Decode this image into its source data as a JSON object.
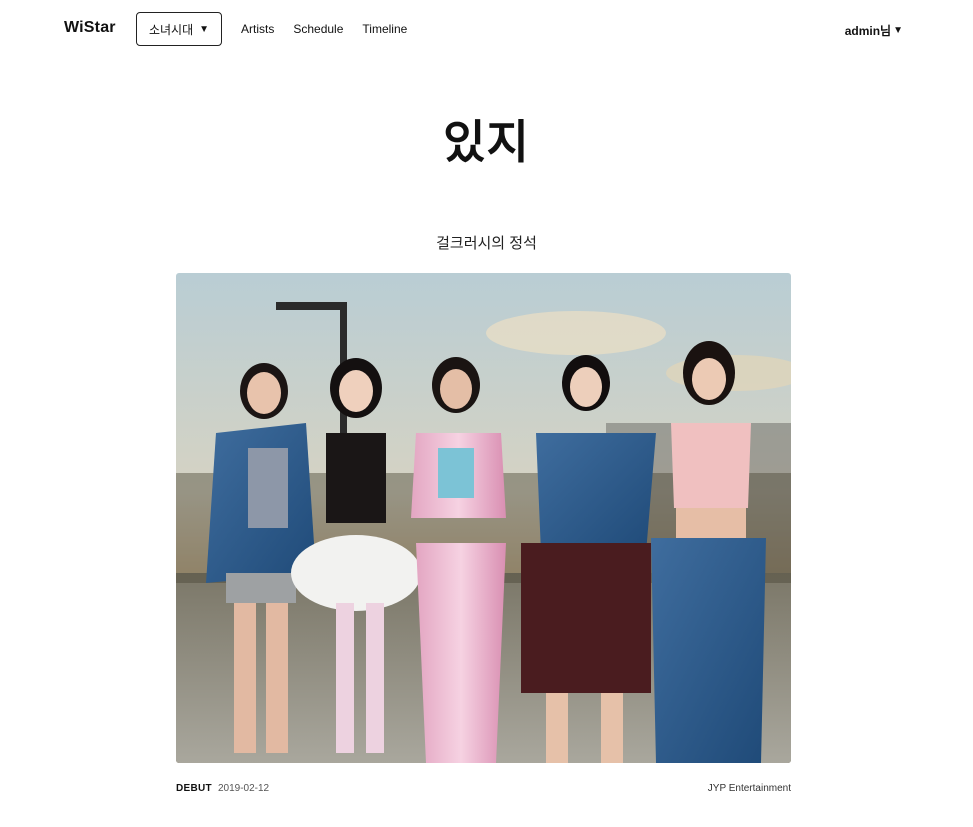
{
  "header": {
    "logo": "WiStar",
    "group_select": {
      "selected": "소녀시대",
      "caret": "▼"
    },
    "nav": [
      "Artists",
      "Schedule",
      "Timeline"
    ],
    "user": {
      "label": "admin님",
      "caret": "▼"
    }
  },
  "artist": {
    "name": "있지",
    "tagline": "걸크러시의 정석",
    "debut_label": "DEBUT",
    "debut_date": "2019-02-12",
    "agency": "JYP Entertainment"
  }
}
